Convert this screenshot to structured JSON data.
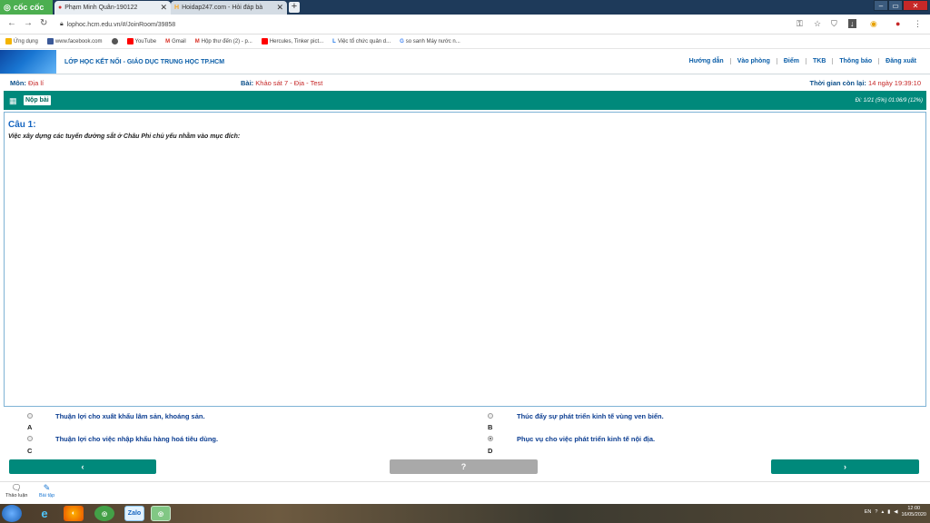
{
  "browser": {
    "brand": "cốc cốc",
    "tabs": [
      {
        "title": "Phạm Minh Quân-190122"
      },
      {
        "title": "Hoidap247.com - Hỏi đáp bà"
      }
    ],
    "new_tab": "+",
    "url": "lophoc.hcm.edu.vn/#/JoinRoom/39858",
    "bookmarks": [
      {
        "label": "Ứng dụng",
        "color": "#f4b400"
      },
      {
        "label": "www.facebook.com",
        "color": "#3b5998"
      },
      {
        "label": "",
        "color": "#555555"
      },
      {
        "label": "YouTube",
        "color": "#ff0000"
      },
      {
        "label": "Gmail",
        "color": "#d93025"
      },
      {
        "label": "Hộp thư đến (2) - p...",
        "color": "#d93025"
      },
      {
        "label": "Hercules, Tinker pict...",
        "color": "#ff0000"
      },
      {
        "label": "Việc tổ chức quản d...",
        "color": "#1a73e8"
      },
      {
        "label": "so sanh Máy nước n...",
        "color": "#4285f4"
      }
    ]
  },
  "site": {
    "name": "LỚP HỌC KẾT NỐI - GIÁO DỤC TRUNG HỌC TP.HCM",
    "nav": [
      "Hướng dẫn",
      "Vào phòng",
      "Điểm",
      "TKB",
      "Thông báo",
      "Đăng xuất"
    ]
  },
  "info": {
    "subject_label": "Môn:",
    "subject_value": "Địa lí",
    "lesson_label": "Bài:",
    "lesson_value": "Khảo sát 7 - Địa - Test",
    "time_label": "Thời gian còn lại:",
    "time_value": "14 ngày 19:39:10"
  },
  "toolbar": {
    "submit_label": "Nộp bài",
    "progress": "Đi: 1/21 (5%)  01:06/9 (12%)"
  },
  "question": {
    "title": "Câu 1:",
    "text": "Việc xây dựng các tuyến đường sắt ở Châu Phi chủ yếu nhằm vào mục đích:",
    "answers": [
      {
        "letter": "A",
        "text": "Thuận lợi cho xuất khẩu lâm sản, khoáng sản.",
        "selected": false
      },
      {
        "letter": "B",
        "text": "Thúc đẩy sự phát triển kinh tế vùng ven biển.",
        "selected": false
      },
      {
        "letter": "C",
        "text": "Thuận lợi cho việc nhập khẩu hàng hoá tiêu dùng.",
        "selected": false
      },
      {
        "letter": "D",
        "text": "Phục vụ cho việc phát triển kinh tế nội địa.",
        "selected": true
      }
    ]
  },
  "bottom_nav": {
    "prev": "‹",
    "mid": "?",
    "next": "›"
  },
  "bottom_tabs": [
    {
      "label": "Thảo luận",
      "icon": "chat-icon"
    },
    {
      "label": "Bài tập",
      "icon": "edit-icon"
    }
  ],
  "taskbar": {
    "zalo_label": "Zalo",
    "lang": "EN",
    "time": "12:00",
    "date": "16/05/2020"
  }
}
